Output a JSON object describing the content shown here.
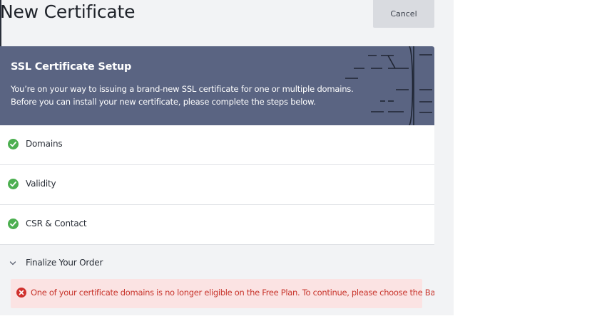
{
  "header": {
    "title": "New Certificate",
    "cancel_label": "Cancel"
  },
  "banner": {
    "title": "SSL Certificate Setup",
    "line1": "You’re on your way to issuing a brand-new SSL certificate for one or multiple domains.",
    "line2": "Before you can install your new certificate, please complete the steps below."
  },
  "steps": [
    {
      "label": "Domains",
      "status": "complete",
      "icon": "check-circle-icon"
    },
    {
      "label": "Validity",
      "status": "complete",
      "icon": "check-circle-icon"
    },
    {
      "label": "CSR & Contact",
      "status": "complete",
      "icon": "check-circle-icon"
    }
  ],
  "final_step": {
    "label": "Finalize Your Order",
    "icon": "chevron-down-icon",
    "alert": {
      "icon": "error-circle-icon",
      "message": "One of your certificate domains is no longer eligible on the Free Plan. To continue, please choose the Basic Plan."
    }
  },
  "colors": {
    "banner_bg": "#5a6482",
    "success": "#4caf50",
    "error": "#d0312d",
    "error_bg": "#fbe3e3"
  }
}
